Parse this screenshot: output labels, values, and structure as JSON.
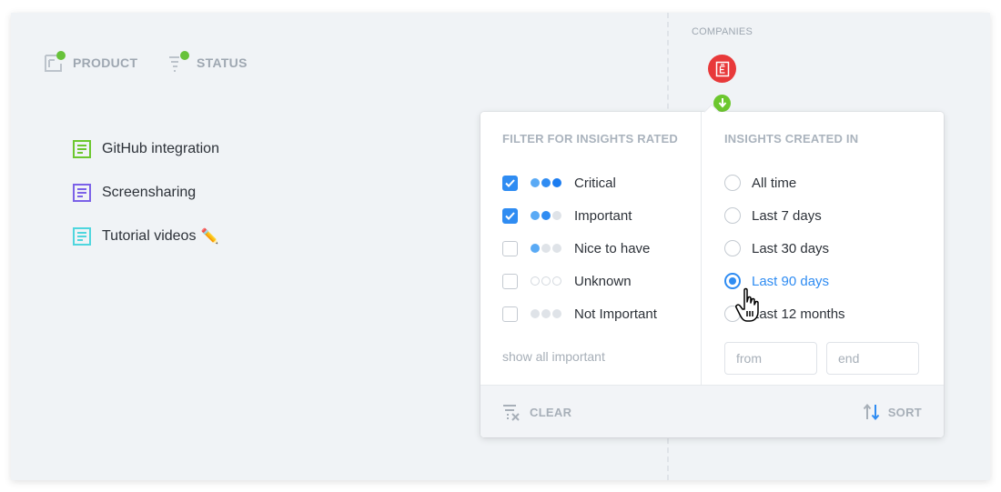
{
  "header": {
    "filters": [
      {
        "label": "PRODUCT",
        "icon": "product-board-icon",
        "active_indicator": true
      },
      {
        "label": "STATUS",
        "icon": "status-filter-icon",
        "active_indicator": true
      }
    ]
  },
  "companies": {
    "label": "COMPANIES",
    "avatar_icon": "company-e-icon",
    "avatar_color": "#e8393a",
    "sort_icon": "arrow-down-icon",
    "sort_color": "#6cc72e"
  },
  "products": [
    {
      "label": "GitHub integration",
      "icon_color": "#6cc72e"
    },
    {
      "label": "Screensharing",
      "icon_color": "#7b61e8"
    },
    {
      "label": "Tutorial videos",
      "icon_color": "#4fd6de",
      "emoji": "✏️"
    }
  ],
  "popover": {
    "rating_filter": {
      "title": "FILTER FOR INSIGHTS RATED",
      "options": [
        {
          "label": "Critical",
          "checked": true,
          "dots": "●●●"
        },
        {
          "label": "Important",
          "checked": true,
          "dots": "●●○"
        },
        {
          "label": "Nice to have",
          "checked": false,
          "dots": "●○○"
        },
        {
          "label": "Unknown",
          "checked": false,
          "dots": "○○○"
        },
        {
          "label": "Not Important",
          "checked": false,
          "dots": "●●●"
        }
      ],
      "show_all_link": "show all important"
    },
    "date_filter": {
      "title": "INSIGHTS CREATED IN",
      "options": [
        {
          "label": "All time",
          "selected": false
        },
        {
          "label": "Last 7 days",
          "selected": false
        },
        {
          "label": "Last 30 days",
          "selected": false
        },
        {
          "label": "Last 90 days",
          "selected": true
        },
        {
          "label": "Last 12 months",
          "selected": false
        }
      ],
      "from_placeholder": "from",
      "end_placeholder": "end"
    },
    "footer": {
      "clear_label": "CLEAR",
      "sort_label": "SORT"
    }
  },
  "colors": {
    "accent": "#2f8cf2",
    "muted": "#9ea7b1",
    "active_dot": "#67c23a"
  }
}
